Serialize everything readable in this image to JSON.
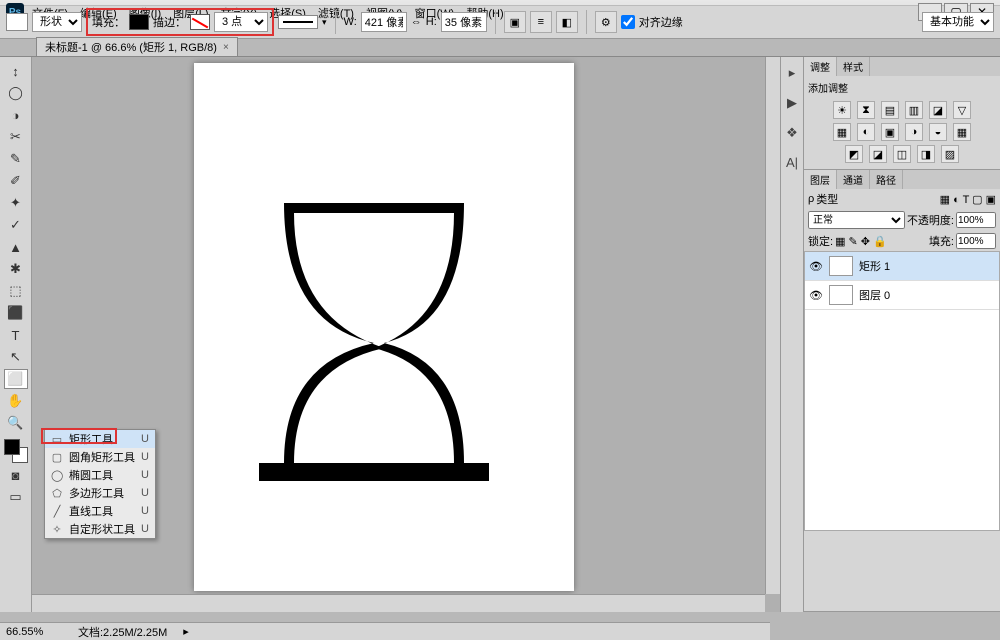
{
  "app": {
    "logo": "Ps"
  },
  "menu": [
    "文件(F)",
    "编辑(E)",
    "图像(I)",
    "图层(L)",
    "文字(Y)",
    "选择(S)",
    "滤镜(T)",
    "视图(V)",
    "窗口(W)",
    "帮助(H)"
  ],
  "options": {
    "mode": "形状",
    "fill_label": "填充：",
    "stroke_label": "描边：",
    "stroke_size": "3 点",
    "w_label": "W:",
    "w_value": "421 像素",
    "h_label": "H:",
    "h_value": "35 像素",
    "align_label": "对齐边缘",
    "workspace": "基本功能"
  },
  "tab": {
    "title": "未标题-1 @ 66.6% (矩形 1, RGB/8)",
    "close": "×"
  },
  "tools": [
    "↕",
    "◯",
    "◑",
    "✂",
    "✎",
    "✐",
    "✦",
    "✓",
    "▲",
    "✱",
    "⬚",
    "⬛",
    "T",
    "↖",
    "⬜",
    "✋",
    "🔍"
  ],
  "shape_flyout": {
    "items": [
      {
        "icon": "▭",
        "label": "矩形工具",
        "short": "U"
      },
      {
        "icon": "▢",
        "label": "圆角矩形工具",
        "short": "U"
      },
      {
        "icon": "◯",
        "label": "椭圆工具",
        "short": "U"
      },
      {
        "icon": "⬠",
        "label": "多边形工具",
        "short": "U"
      },
      {
        "icon": "╱",
        "label": "直线工具",
        "short": "U"
      },
      {
        "icon": "✧",
        "label": "自定形状工具",
        "short": "U"
      }
    ]
  },
  "dock_icons": [
    "▸",
    "▶",
    "❖",
    "A|"
  ],
  "panels": {
    "adjust_tabs": [
      "调整",
      "样式"
    ],
    "adjust_title": "添加调整",
    "adj_icons_1": [
      "☀",
      "⧗",
      "▤",
      "▥",
      "◪",
      "▽"
    ],
    "adj_icons_2": [
      "▦",
      "◐",
      "▣",
      "◑",
      "◒",
      "▦"
    ],
    "adj_icons_3": [
      "◩",
      "◪",
      "◫",
      "◨",
      "▨"
    ],
    "layer_tabs": [
      "图层",
      "通道",
      "路径"
    ],
    "layer_mode": "正常",
    "opacity_label": "不透明度:",
    "opacity_value": "100%",
    "lock_label": "锁定:",
    "fill_label": "填充:",
    "fill_value": "100%",
    "type_label": "类型",
    "layers": [
      {
        "name": "矩形 1",
        "sel": true
      },
      {
        "name": "图层 0",
        "sel": false
      }
    ]
  },
  "status": {
    "zoom": "66.55%",
    "doc": "文档:2.25M/2.25M"
  }
}
